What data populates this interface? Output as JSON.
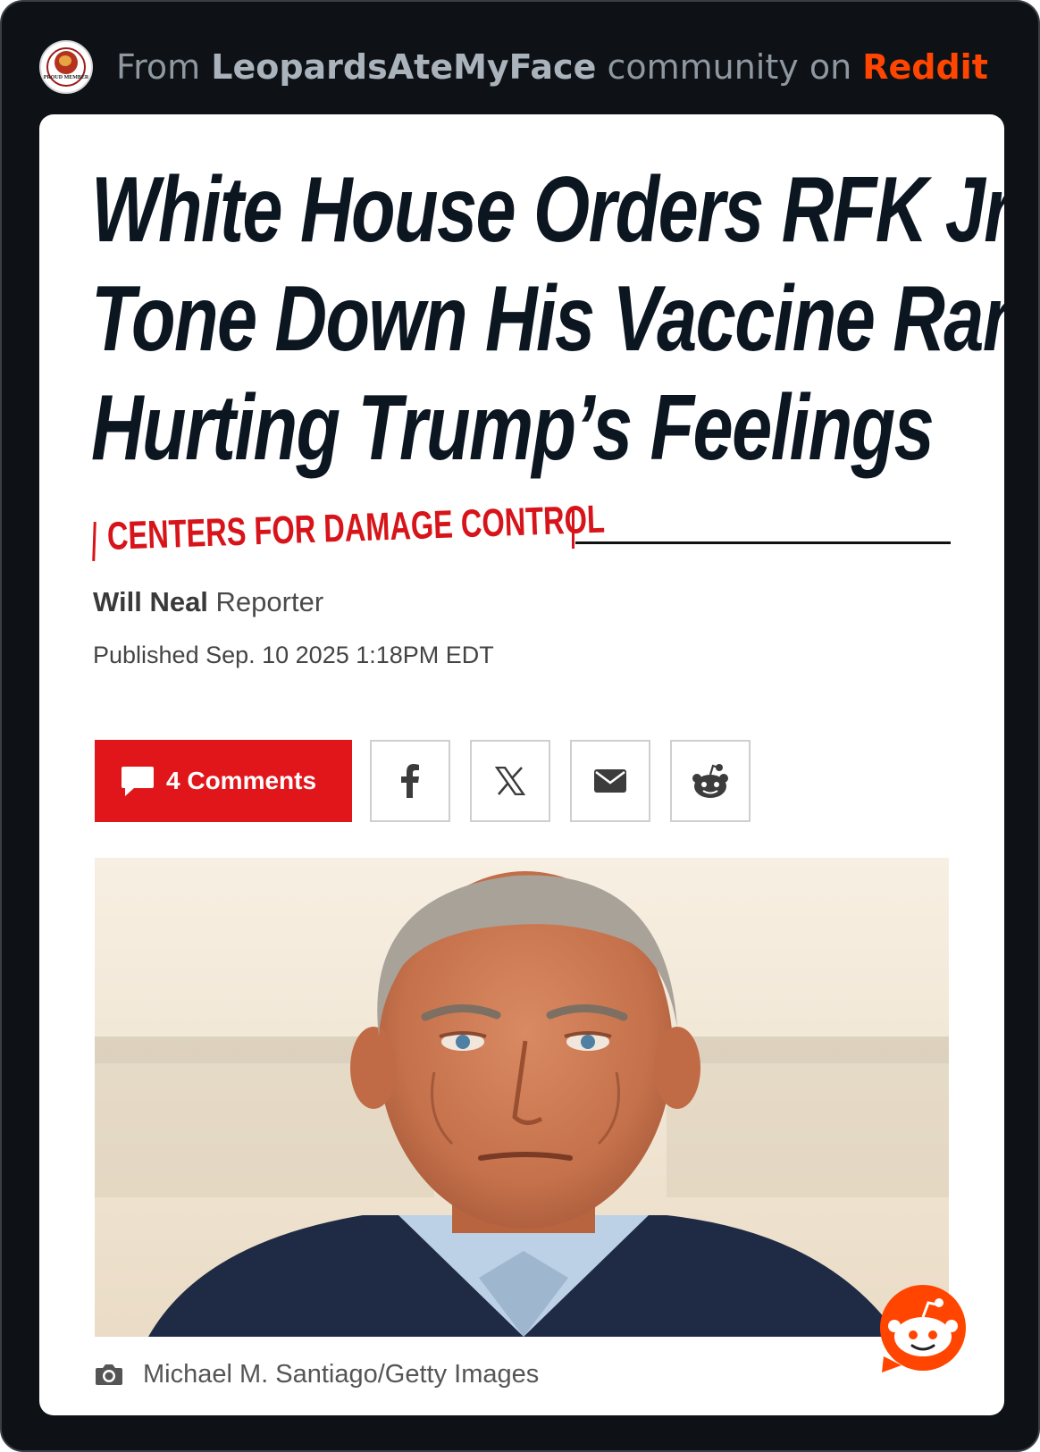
{
  "header": {
    "prefix": "From",
    "community": "LeopardsAteMyFace",
    "middle": "community on",
    "brand": "Reddit",
    "badge_text": "PROUD MEMBER"
  },
  "article": {
    "headline_lines": [
      "White House Orders RFK Jr. to",
      "Tone Down His Vaccine Rants",
      "Hurting Trump’s Feelings"
    ],
    "tag": "CENTERS FOR DAMAGE CONTROL",
    "author": "Will Neal",
    "role": "Reporter",
    "published": "Published Sep. 10 2025 1:18PM EDT",
    "comments_label": "4 Comments",
    "share_buttons": [
      "facebook-icon",
      "x-icon",
      "email-icon",
      "reddit-icon"
    ],
    "photo_credit": "Michael M. Santiago/Getty Images"
  },
  "colors": {
    "background": "#0e1216",
    "accent_red": "#e1161b",
    "reddit_orange": "#ff4500",
    "headline": "#0b1620"
  }
}
